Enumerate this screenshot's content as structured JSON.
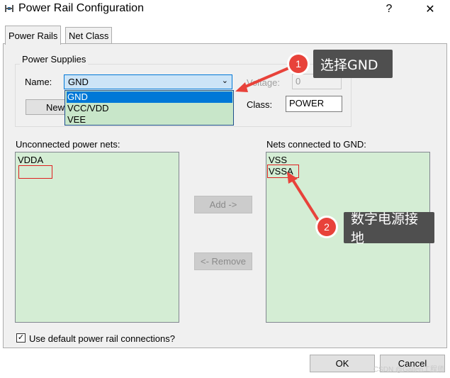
{
  "window": {
    "title": "Power Rail Configuration",
    "help_label": "?",
    "close_label": "✕"
  },
  "tabs": [
    {
      "label": "Power Rails"
    },
    {
      "label": "Net Class"
    }
  ],
  "power_supplies": {
    "group_title": "Power Supplies",
    "name_label": "Name:",
    "name_value": "GND",
    "dropdown_options": [
      "GND",
      "VCC/VDD",
      "VEE"
    ],
    "new_button": "New",
    "voltage_label": "Voltage:",
    "voltage_value": "0",
    "class_label": "Class:",
    "class_value": "POWER"
  },
  "unconnected": {
    "label": "Unconnected power nets:",
    "items": [
      "VDDA"
    ]
  },
  "connected": {
    "label": "Nets connected to GND:",
    "items": [
      "VSS",
      "VSSA"
    ]
  },
  "buttons": {
    "add": "Add ->",
    "remove": "<- Remove",
    "ok": "OK",
    "cancel": "Cancel"
  },
  "default_connections": {
    "label": "Use default power rail connections?",
    "checked_mark": "✓"
  },
  "annotations": [
    {
      "number": "1",
      "text": "选择GND"
    },
    {
      "number": "2",
      "text": "数字电源接地"
    }
  ],
  "watermark": "CSDN @Gallen工程师",
  "colors": {
    "accent": "#0078d7",
    "list_bg": "#d4edd4",
    "highlight_red": "#e02020",
    "callout_bg": "#4f4f4f",
    "badge_red": "#e8423a"
  }
}
